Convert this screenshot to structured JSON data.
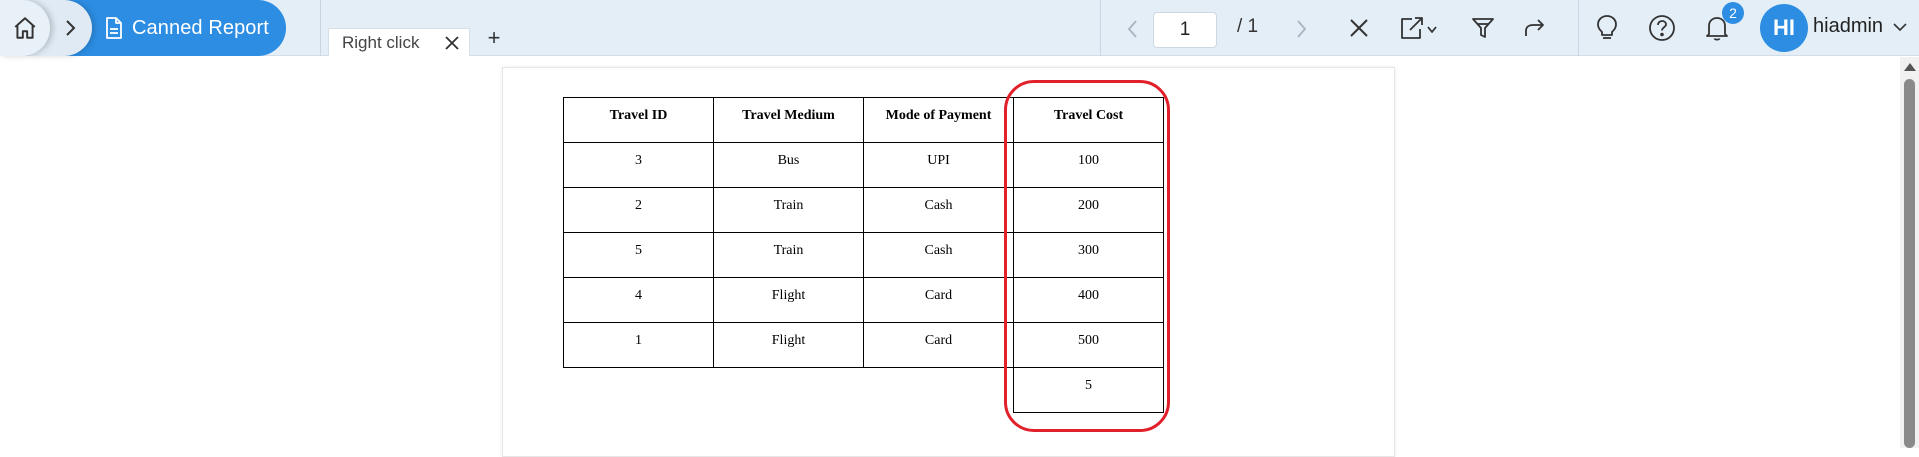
{
  "nav": {
    "home_icon": "home-icon",
    "breadcrumb_current": "Canned Report",
    "breadcrumb_icon": "document-icon"
  },
  "tabs": [
    {
      "label": "Right click",
      "active": true
    }
  ],
  "add_tab_label": "+",
  "pagination": {
    "current_page": "1",
    "total_label": "/  1"
  },
  "toolbar": {
    "icons": [
      "close-icon",
      "export-icon",
      "filter-icon",
      "share-icon",
      "lightbulb-icon",
      "help-icon",
      "bell-icon"
    ]
  },
  "notifications": {
    "count": "2"
  },
  "user": {
    "initials": "HI",
    "name": "hiadmin"
  },
  "report": {
    "headers": [
      "Travel ID",
      "Travel Medium",
      "Mode of Payment",
      "Travel Cost"
    ],
    "rows": [
      [
        "3",
        "Bus",
        "UPI",
        "100"
      ],
      [
        "2",
        "Train",
        "Cash",
        "200"
      ],
      [
        "5",
        "Train",
        "Cash",
        "300"
      ],
      [
        "4",
        "Flight",
        "Card",
        "400"
      ],
      [
        "1",
        "Flight",
        "Card",
        "500"
      ]
    ],
    "summary_cost": "5"
  },
  "colors": {
    "accent": "#2d8de3",
    "topbar_bg": "#e3eef7",
    "highlight": "#e0202a"
  }
}
